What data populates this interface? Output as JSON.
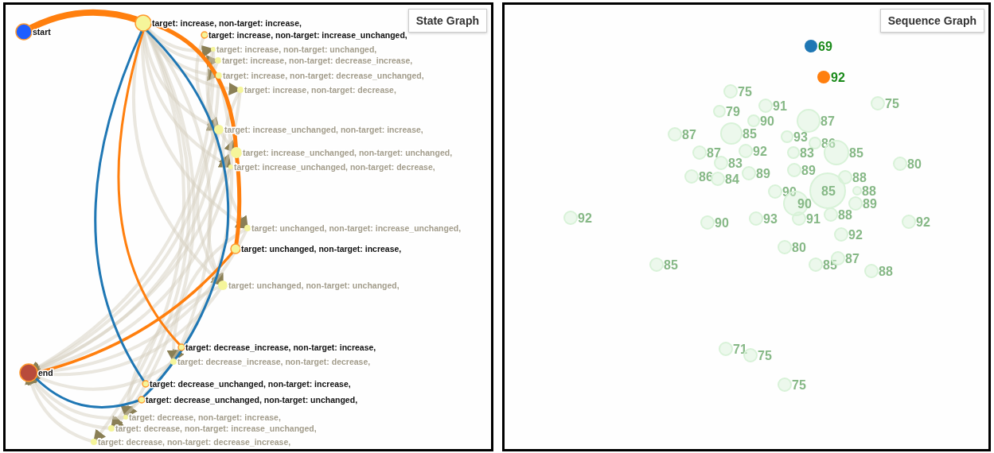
{
  "state_graph": {
    "title": "State Graph",
    "nodes": [
      {
        "label": "start",
        "highlighted": true,
        "color": "#1f5eff"
      },
      {
        "label": "target: increase, non-target: increase,",
        "highlighted": true,
        "color": "#f5f59a"
      },
      {
        "label": "target: increase, non-target: increase_unchanged,",
        "highlighted": true,
        "color": "#f5f59a"
      },
      {
        "label": "target: increase, non-target: unchanged,",
        "highlighted": false,
        "color": "#f5f59a"
      },
      {
        "label": "target: increase, non-target: decrease_increase,",
        "highlighted": false,
        "color": "#f5f59a"
      },
      {
        "label": "target: increase, non-target: decrease_unchanged,",
        "highlighted": false,
        "color": "#f5f59a"
      },
      {
        "label": "target: increase, non-target: decrease,",
        "highlighted": false,
        "color": "#f5f59a"
      },
      {
        "label": "target: increase_unchanged, non-target: increase,",
        "highlighted": false,
        "color": "#f5f59a"
      },
      {
        "label": "target: increase_unchanged, non-target: unchanged,",
        "highlighted": false,
        "color": "#f5f59a"
      },
      {
        "label": "target: increase_unchanged, non-target: decrease,",
        "highlighted": false,
        "color": "#f5f59a"
      },
      {
        "label": "target: unchanged, non-target: increase_unchanged,",
        "highlighted": false,
        "color": "#f5f59a"
      },
      {
        "label": "target: unchanged, non-target: increase,",
        "highlighted": true,
        "color": "#f5f59a"
      },
      {
        "label": "target: unchanged, non-target: unchanged,",
        "highlighted": false,
        "color": "#f5f59a"
      },
      {
        "label": "target: decrease_increase, non-target: increase,",
        "highlighted": true,
        "color": "#f5f59a"
      },
      {
        "label": "target: decrease_increase, non-target: decrease,",
        "highlighted": false,
        "color": "#f5f59a"
      },
      {
        "label": "target: decrease_unchanged, non-target: increase,",
        "highlighted": true,
        "color": "#f5f59a"
      },
      {
        "label": "target: decrease_unchanged, non-target: unchanged,",
        "highlighted": true,
        "color": "#f5f59a"
      },
      {
        "label": "target: decrease, non-target: increase,",
        "highlighted": false,
        "color": "#f5f59a"
      },
      {
        "label": "target: decrease, non-target: increase_unchanged,",
        "highlighted": false,
        "color": "#f5f59a"
      },
      {
        "label": "target: decrease, non-target: decrease_increase,",
        "highlighted": false,
        "color": "#f5f59a"
      },
      {
        "label": "end",
        "highlighted": true,
        "color": "#b84c3c"
      }
    ]
  },
  "sequence_graph": {
    "title": "Sequence Graph",
    "points": [
      {
        "label": "69",
        "highlighted": true,
        "color": "#1f77b4"
      },
      {
        "label": "92",
        "highlighted": true,
        "color": "#ff7f0e"
      },
      {
        "label": "75",
        "highlighted": false,
        "color": "#d8f2d8"
      },
      {
        "label": "91",
        "highlighted": false,
        "color": "#d8f2d8"
      },
      {
        "label": "79",
        "highlighted": false,
        "color": "#d8f2d8"
      },
      {
        "label": "90",
        "highlighted": false,
        "color": "#d8f2d8"
      },
      {
        "label": "85",
        "highlighted": false,
        "color": "#d8f2d8"
      },
      {
        "label": "87",
        "highlighted": false,
        "color": "#d8f2d8"
      },
      {
        "label": "87",
        "highlighted": false,
        "color": "#d8f2d8"
      },
      {
        "label": "87",
        "highlighted": false,
        "color": "#d8f2d8"
      },
      {
        "label": "92",
        "highlighted": false,
        "color": "#d8f2d8"
      },
      {
        "label": "83",
        "highlighted": false,
        "color": "#d8f2d8"
      },
      {
        "label": "86",
        "highlighted": false,
        "color": "#d8f2d8"
      },
      {
        "label": "84",
        "highlighted": false,
        "color": "#d8f2d8"
      },
      {
        "label": "89",
        "highlighted": false,
        "color": "#d8f2d8"
      },
      {
        "label": "93",
        "highlighted": false,
        "color": "#d8f2d8"
      },
      {
        "label": "86",
        "highlighted": false,
        "color": "#d8f2d8"
      },
      {
        "label": "83",
        "highlighted": false,
        "color": "#d8f2d8"
      },
      {
        "label": "85",
        "highlighted": false,
        "color": "#d8f2d8"
      },
      {
        "label": "89",
        "highlighted": false,
        "color": "#d8f2d8"
      },
      {
        "label": "75",
        "highlighted": false,
        "color": "#d8f2d8"
      },
      {
        "label": "80",
        "highlighted": false,
        "color": "#d8f2d8"
      },
      {
        "label": "88",
        "highlighted": false,
        "color": "#d8f2d8"
      },
      {
        "label": "90",
        "highlighted": false,
        "color": "#d8f2d8"
      },
      {
        "label": "85",
        "highlighted": false,
        "color": "#d8f2d8"
      },
      {
        "label": "88",
        "highlighted": false,
        "color": "#d8f2d8"
      },
      {
        "label": "90",
        "highlighted": false,
        "color": "#d8f2d8"
      },
      {
        "label": "89",
        "highlighted": false,
        "color": "#d8f2d8"
      },
      {
        "label": "92",
        "highlighted": false,
        "color": "#d8f2d8"
      },
      {
        "label": "90",
        "highlighted": false,
        "color": "#d8f2d8"
      },
      {
        "label": "93",
        "highlighted": false,
        "color": "#d8f2d8"
      },
      {
        "label": "91",
        "highlighted": false,
        "color": "#d8f2d8"
      },
      {
        "label": "88",
        "highlighted": false,
        "color": "#d8f2d8"
      },
      {
        "label": "92",
        "highlighted": false,
        "color": "#d8f2d8"
      },
      {
        "label": "92",
        "highlighted": false,
        "color": "#d8f2d8"
      },
      {
        "label": "80",
        "highlighted": false,
        "color": "#d8f2d8"
      },
      {
        "label": "85",
        "highlighted": false,
        "color": "#d8f2d8"
      },
      {
        "label": "85",
        "highlighted": false,
        "color": "#d8f2d8"
      },
      {
        "label": "87",
        "highlighted": false,
        "color": "#d8f2d8"
      },
      {
        "label": "88",
        "highlighted": false,
        "color": "#d8f2d8"
      },
      {
        "label": "71",
        "highlighted": false,
        "color": "#d8f2d8"
      },
      {
        "label": "75",
        "highlighted": false,
        "color": "#d8f2d8"
      },
      {
        "label": "75",
        "highlighted": false,
        "color": "#d8f2d8"
      }
    ]
  }
}
